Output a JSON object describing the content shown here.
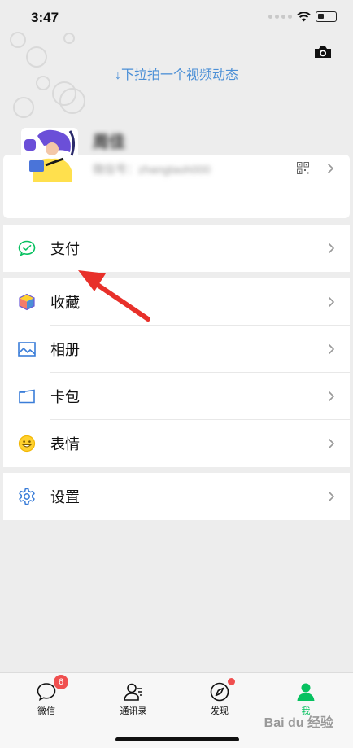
{
  "status_bar": {
    "time": "3:47"
  },
  "pull_hint": "↓下拉拍一个视频动态",
  "profile": {
    "nickname": "周佳",
    "wechat_id": "微信号：zhangtaoh000"
  },
  "menu_groups": [
    {
      "items": [
        {
          "label": "支付",
          "icon": "pay-icon"
        }
      ]
    },
    {
      "items": [
        {
          "label": "收藏",
          "icon": "favorites-icon"
        },
        {
          "label": "相册",
          "icon": "album-icon"
        },
        {
          "label": "卡包",
          "icon": "cards-icon"
        },
        {
          "label": "表情",
          "icon": "emoji-icon"
        }
      ]
    },
    {
      "items": [
        {
          "label": "设置",
          "icon": "settings-icon"
        }
      ]
    }
  ],
  "tabs": [
    {
      "label": "微信",
      "icon": "chat-icon",
      "badge": "6"
    },
    {
      "label": "通讯录",
      "icon": "contacts-icon"
    },
    {
      "label": "发现",
      "icon": "discover-icon",
      "dot": true
    },
    {
      "label": "我",
      "icon": "me-icon",
      "active": true
    }
  ],
  "watermark": "Bai du 经验",
  "colors": {
    "accent": "#07c160",
    "link": "#4b8fd6",
    "badge": "#f04f4f",
    "annotation_arrow": "#e8302a"
  }
}
